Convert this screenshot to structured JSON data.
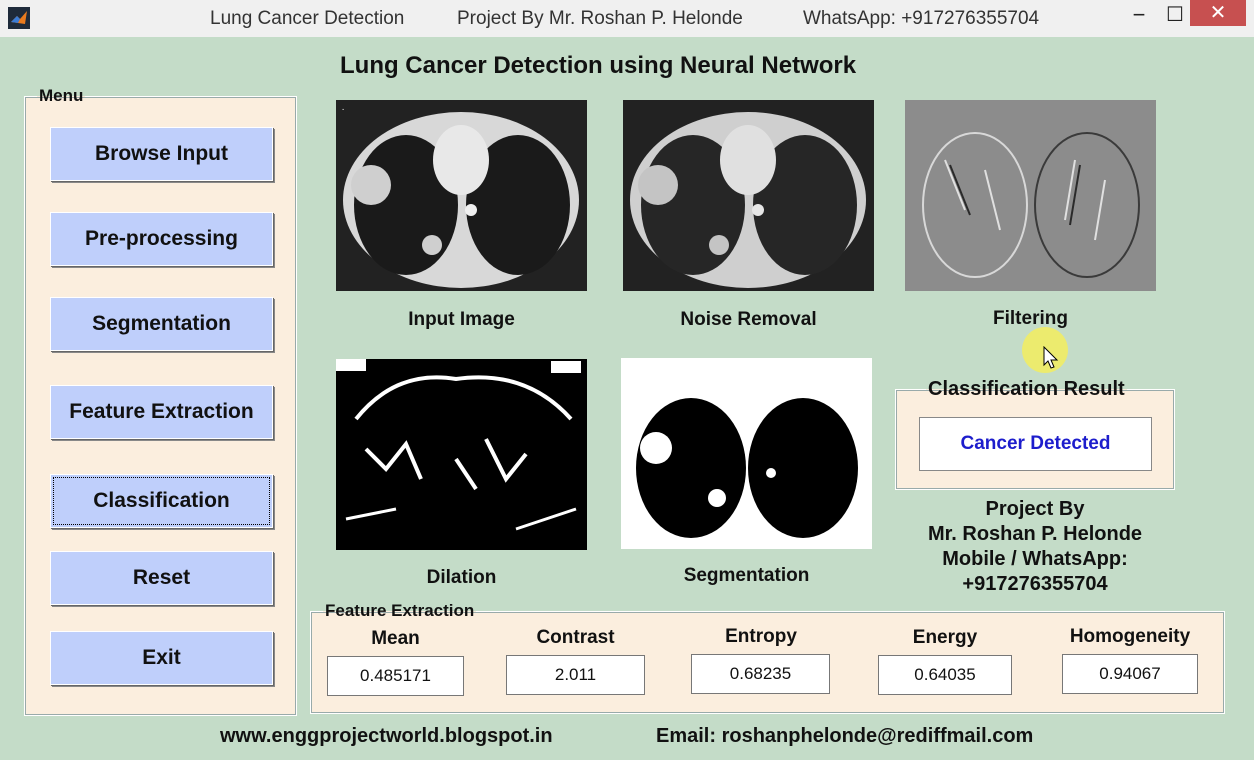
{
  "titlebar": {
    "title": "Lung Cancer Detection",
    "project": "Project By Mr. Roshan P. Helonde",
    "whatsapp": "WhatsApp: +917276355704",
    "minimize": "−",
    "maximize": "☐",
    "close": "✕"
  },
  "heading": "Lung Cancer Detection using Neural Network",
  "menu": {
    "legend": "Menu",
    "buttons": [
      "Browse Input",
      "Pre-processing",
      "Segmentation",
      "Feature Extraction",
      "Classification",
      "Reset",
      "Exit"
    ]
  },
  "images": {
    "input": "Input Image",
    "noise": "Noise Removal",
    "filtering": "Filtering",
    "dilation": "Dilation",
    "segmentation": "Segmentation"
  },
  "classification": {
    "legend": "Classification Result",
    "result": "Cancer Detected"
  },
  "project_info": {
    "line1": "Project By",
    "line2": "Mr. Roshan P. Helonde",
    "line3": "Mobile / WhatsApp:",
    "line4": "+917276355704"
  },
  "features": {
    "legend": "Feature Extraction",
    "items": [
      {
        "label": "Mean",
        "value": "0.485171"
      },
      {
        "label": "Contrast",
        "value": "2.011"
      },
      {
        "label": "Entropy",
        "value": "0.68235"
      },
      {
        "label": "Energy",
        "value": "0.64035"
      },
      {
        "label": "Homogeneity",
        "value": "0.94067"
      }
    ]
  },
  "footer": {
    "website": "www.enggprojectworld.blogspot.in",
    "email": "Email: roshanphelonde@rediffmail.com"
  },
  "colors": {
    "background": "#c4dcc8",
    "panel": "#fbeede",
    "button": "#bfcffb",
    "result_text": "#1d1dcc",
    "close_button": "#c75050"
  }
}
